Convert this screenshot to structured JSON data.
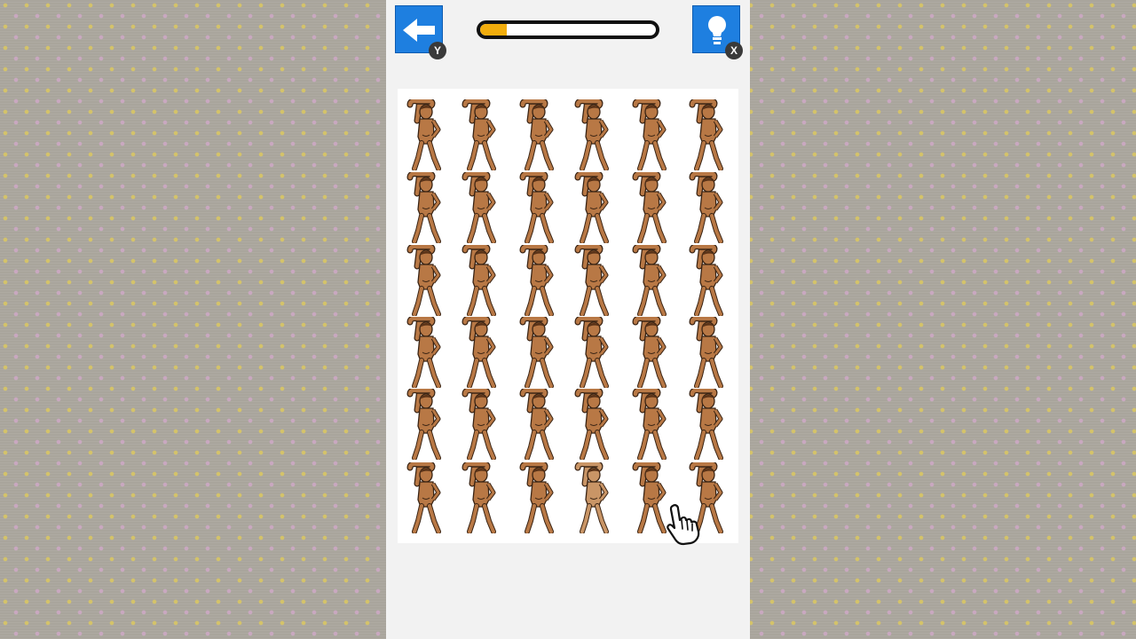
{
  "header": {
    "back_button": {
      "icon": "arrow-left-icon",
      "controller_key": "Y"
    },
    "hint_button": {
      "icon": "lightbulb-icon",
      "controller_key": "X"
    },
    "progress": {
      "fraction": 0.15,
      "fill_color": "#f2ad0c"
    }
  },
  "puzzle": {
    "rows": 6,
    "columns": 6,
    "figure": "stretching-person",
    "odd_one_out": {
      "row": 6,
      "column": 4
    }
  },
  "cursor": {
    "icon": "hand-pointer-icon"
  },
  "colors": {
    "button_blue": "#1e7fe0",
    "figure_skin": "#b87845",
    "figure_odd_skin": "#c99566",
    "panel": "#f2f2f2"
  }
}
